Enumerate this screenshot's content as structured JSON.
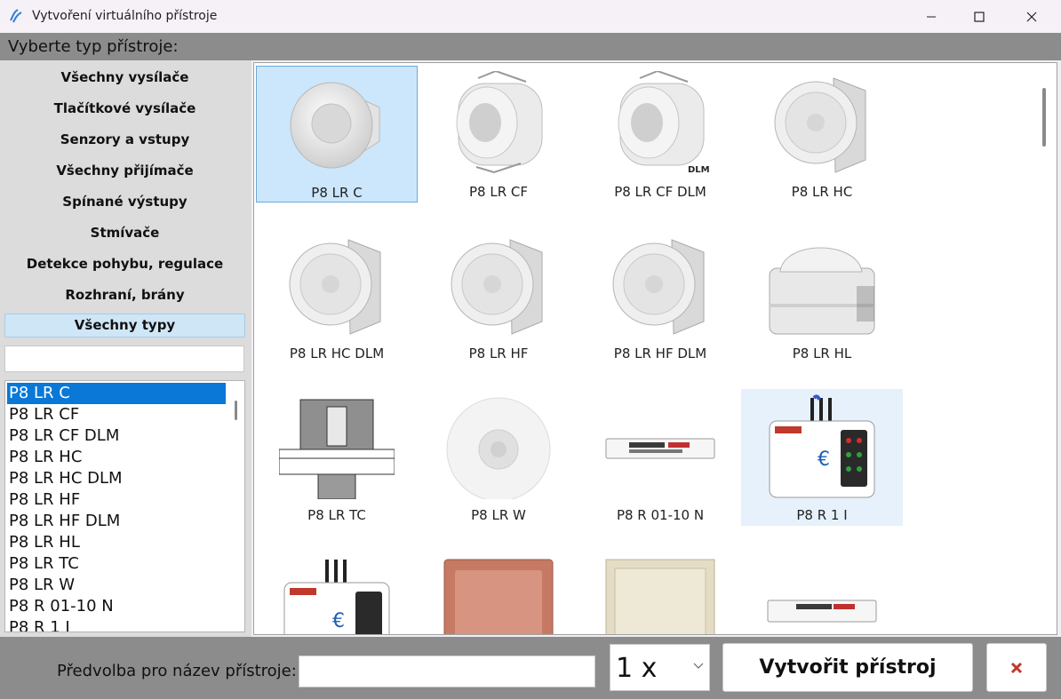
{
  "window": {
    "title": "Vytvoření virtuálního přístroje"
  },
  "header": {
    "title": "Vyberte typ přístroje:"
  },
  "categories": [
    {
      "label": "Všechny vysílače",
      "selected": false
    },
    {
      "label": "Tlačítkové vysílače",
      "selected": false
    },
    {
      "label": "Senzory a vstupy",
      "selected": false
    },
    {
      "label": "Všechny přijímače",
      "selected": false
    },
    {
      "label": "Spínané výstupy",
      "selected": false
    },
    {
      "label": "Stmívače",
      "selected": false
    },
    {
      "label": "Detekce pohybu, regulace",
      "selected": false
    },
    {
      "label": "Rozhraní, brány",
      "selected": false
    },
    {
      "label": "Všechny typy",
      "selected": true
    }
  ],
  "filter": {
    "value": ""
  },
  "device_list": {
    "selected_index": 0,
    "items": [
      "P8 LR C",
      "P8 LR CF",
      "P8 LR CF DLM",
      "P8 LR HC",
      "P8 LR HC DLM",
      "P8 LR HF",
      "P8 LR HF DLM",
      "P8 LR HL",
      "P8 LR TC",
      "P8 LR W",
      "P8 R 01-10 N",
      "P8 R 1 I"
    ]
  },
  "grid": {
    "tiles": [
      {
        "label": "P8 LR C",
        "icon": "dome-sensor-icon",
        "state": "selected"
      },
      {
        "label": "P8 LR CF",
        "icon": "flush-sensor-icon",
        "state": ""
      },
      {
        "label": "P8 LR CF DLM",
        "icon": "flush-sensor-icon",
        "badge": "DLM",
        "state": ""
      },
      {
        "label": "P8 LR HC",
        "icon": "ceiling-sensor-icon",
        "state": ""
      },
      {
        "label": "P8 LR HC DLM",
        "icon": "ceiling-sensor-icon",
        "state": ""
      },
      {
        "label": "P8 LR HF",
        "icon": "ceiling-sensor-icon",
        "state": ""
      },
      {
        "label": "P8 LR HF DLM",
        "icon": "ceiling-sensor-icon",
        "state": ""
      },
      {
        "label": "P8 LR HL",
        "icon": "high-bay-sensor-icon",
        "state": ""
      },
      {
        "label": "P8 LR TC",
        "icon": "tc-drawing-icon",
        "state": ""
      },
      {
        "label": "P8 LR W",
        "icon": "round-sensor-icon",
        "state": ""
      },
      {
        "label": "P8 R 01-10 N",
        "icon": "strip-module-icon",
        "state": ""
      },
      {
        "label": "P8 R 1 I",
        "icon": "flush-module-icon",
        "state": "hover"
      },
      {
        "label": "",
        "icon": "flush-module-icon",
        "state": ""
      },
      {
        "label": "",
        "icon": "copper-switch-icon",
        "state": ""
      },
      {
        "label": "",
        "icon": "beige-switch-icon",
        "state": ""
      },
      {
        "label": "",
        "icon": "strip-module-icon",
        "state": ""
      }
    ]
  },
  "footer": {
    "prefix_label": "Předvolba pro název přístroje:",
    "prefix_value": "",
    "count_value": "1 x",
    "create_label": "Vytvořit přístroj"
  },
  "colors": {
    "accent": "#0a78d7",
    "selected_tile": "#cce6fb",
    "hover_tile": "#e6f1fb",
    "band": "#8c8c8c",
    "close_x": "#c0392b"
  }
}
